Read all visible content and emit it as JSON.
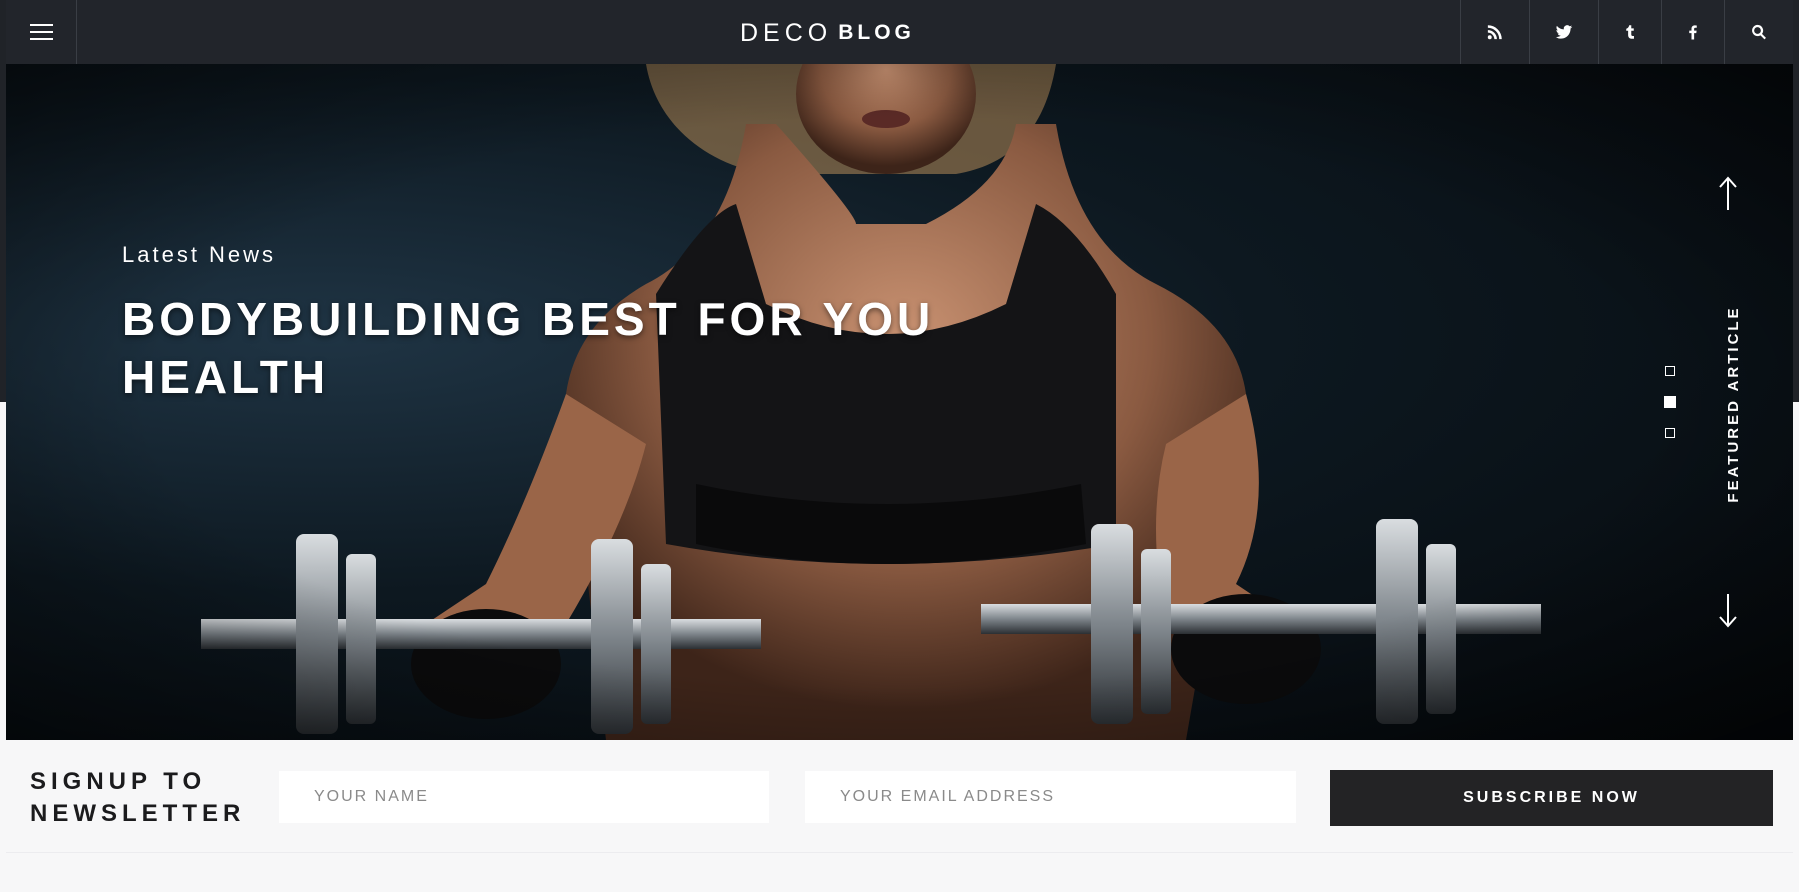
{
  "header": {
    "logo_primary": "DECO",
    "logo_secondary": "BLOG",
    "social": [
      {
        "icon": "rss-icon"
      },
      {
        "icon": "twitter-icon"
      },
      {
        "icon": "tumblr-icon"
      },
      {
        "icon": "facebook-icon"
      },
      {
        "icon": "search-icon"
      }
    ]
  },
  "hero": {
    "category": "Latest News",
    "title": "BODYBUILDING BEST FOR YOU HEALTH",
    "side_label": "FEATURED ARTICLE",
    "active_slide": 2,
    "slide_count": 3
  },
  "newsletter": {
    "title": "SIGNUP TO NEWSLETTER",
    "name_placeholder": "YOUR NAME",
    "email_placeholder": "YOUR EMAIL ADDRESS",
    "button_label": "SUBSCRIBE NOW"
  },
  "colors": {
    "header_bg": "#22252b",
    "button_bg": "#232325",
    "page_bg": "#f7f7f8"
  }
}
